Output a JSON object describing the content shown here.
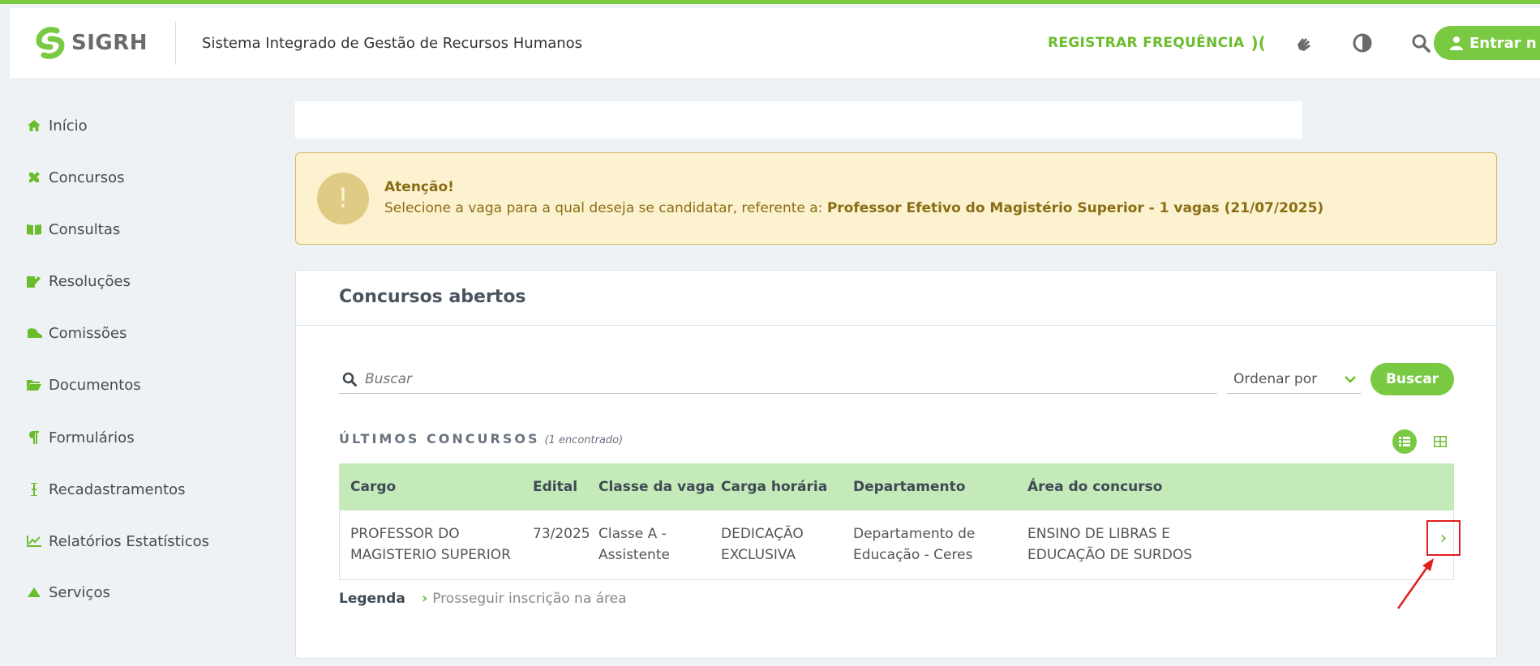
{
  "header": {
    "logo_text": "SIGRH",
    "system_title": "Sistema Integrado de Gestão de Recursos Humanos",
    "register_label": "REGISTRAR FREQUÊNCIA",
    "register_glyph": ")(",
    "login_label": "Entrar n",
    "icons": [
      "sign-language-icon",
      "contrast-icon",
      "search-icon",
      "user-icon"
    ]
  },
  "sidebar": {
    "items": [
      {
        "label": "Início",
        "icon": "home-icon"
      },
      {
        "label": "Concursos",
        "icon": "tools-icon"
      },
      {
        "label": "Consultas",
        "icon": "book-icon"
      },
      {
        "label": "Resoluções",
        "icon": "edit-icon"
      },
      {
        "label": "Comissões",
        "icon": "hat-icon"
      },
      {
        "label": "Documentos",
        "icon": "folder-icon"
      },
      {
        "label": "Formulários",
        "icon": "paragraph-icon"
      },
      {
        "label": "Recadastramentos",
        "icon": "cursor-icon"
      },
      {
        "label": "Relatórios Estatísticos",
        "icon": "chart-icon"
      },
      {
        "label": "Serviços",
        "icon": "triangle-icon"
      }
    ]
  },
  "alert": {
    "title": "Atenção!",
    "text_prefix": "Selecione a vaga para a qual deseja se candidatar, referente a: ",
    "text_bold": "Professor Efetivo do Magistério Superior - 1 vagas (21/07/2025)",
    "icon": "!"
  },
  "card": {
    "title": "Concursos abertos",
    "search_placeholder": "Buscar",
    "order_label": "Ordenar por",
    "search_button": "Buscar",
    "section_title": "ÚLTIMOS CONCURSOS",
    "section_count": "(1 encontrado)"
  },
  "table": {
    "headers": [
      "Cargo",
      "Edital",
      "Classe da vaga",
      "Carga horária",
      "Departamento",
      "Área do concurso"
    ],
    "rows": [
      {
        "cargo": "PROFESSOR DO MAGISTERIO SUPERIOR",
        "edital": "73/2025",
        "classe": "Classe A - Assistente",
        "carga": "DEDICAÇÃO EXCLUSIVA",
        "departamento": "Departamento de Educação - Ceres",
        "area": "ENSINO DE LIBRAS E EDUCAÇÃO DE SURDOS",
        "action": "›"
      }
    ]
  },
  "legend": {
    "title": "Legenda",
    "chevron": "›",
    "item": "Prosseguir inscrição na área"
  },
  "colors": {
    "accent": "#7ac943",
    "alert_bg": "#fcf2cf",
    "alert_text": "#8a6d14",
    "table_header": "#c3eab8",
    "highlight": "#e01e1e"
  }
}
